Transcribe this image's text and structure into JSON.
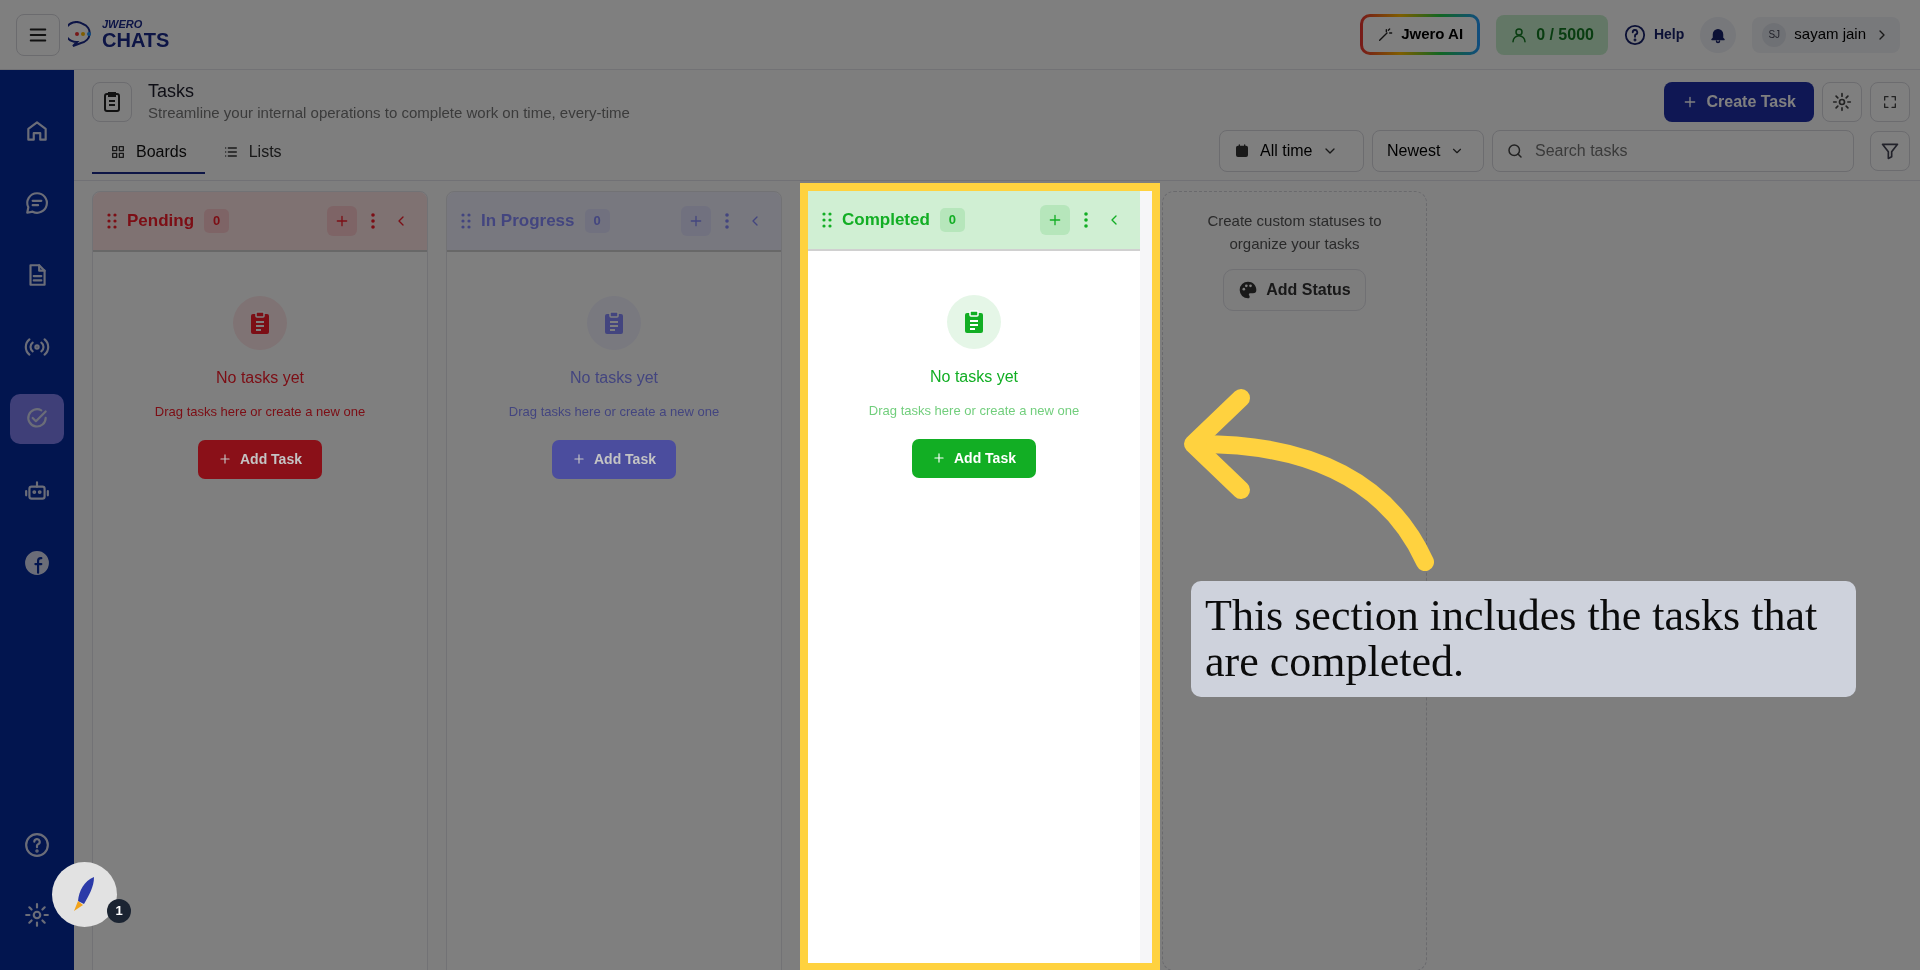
{
  "topbar": {
    "logo_top": "JWERO",
    "logo_bottom": "CHATS",
    "ai_button": "Jwero AI",
    "credits": "0 / 5000",
    "help": "Help",
    "user_initials": "SJ",
    "user_name": "sayam jain"
  },
  "sidebar": {
    "items": [
      {
        "kind": "home",
        "selected": false
      },
      {
        "kind": "chat",
        "selected": false
      },
      {
        "kind": "document",
        "selected": false
      },
      {
        "kind": "broadcast",
        "selected": false
      },
      {
        "kind": "tasks",
        "selected": true
      },
      {
        "kind": "bot",
        "selected": false
      },
      {
        "kind": "facebook",
        "selected": false
      }
    ],
    "bottom_items": [
      {
        "kind": "help",
        "selected": false
      },
      {
        "kind": "settings",
        "selected": false
      }
    ]
  },
  "page": {
    "title": "Tasks",
    "subtitle": "Streamline your internal operations to complete work on time, every-time",
    "create_button": "Create Task"
  },
  "tabs": [
    {
      "label": "Boards",
      "kind": "boards",
      "selected": true
    },
    {
      "label": "Lists",
      "kind": "lists",
      "selected": false
    }
  ],
  "filters": {
    "date": "All time",
    "sort": "Newest",
    "search_placeholder": "Search tasks"
  },
  "columns": [
    {
      "title": "Pending",
      "count": "0",
      "color": "#8a1018",
      "highlighted": false,
      "empty_title": "No tasks yet",
      "empty_hint": "Drag tasks here or create a new one",
      "add_button": "Add Task"
    },
    {
      "title": "In Progress",
      "count": "0",
      "color": "#4b4d9e",
      "highlighted": false,
      "empty_title": "No tasks yet",
      "empty_hint": "Drag tasks here or create a new one",
      "add_button": "Add Task"
    },
    {
      "title": "Completed",
      "count": "0",
      "color": "#12ae24",
      "highlighted": true,
      "empty_title": "No tasks yet",
      "empty_hint": "Drag tasks here or create a new one",
      "add_button": "Add Task"
    }
  ],
  "add_status": {
    "hint": "Create custom statuses to organize your tasks",
    "button": "Add Status"
  },
  "launcher": {
    "badge": "1"
  },
  "callout": {
    "text": "This section includes the tasks that are completed."
  }
}
